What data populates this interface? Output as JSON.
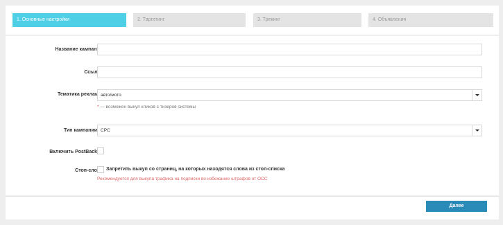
{
  "steps": [
    {
      "label": "1. Основные настройки",
      "active": true
    },
    {
      "label": "2. Таргетинг",
      "active": false
    },
    {
      "label": "3. Трекинг",
      "active": false
    },
    {
      "label": "4. Объявления",
      "active": false
    }
  ],
  "form": {
    "campaign_name": {
      "label": "Название кампании",
      "value": ""
    },
    "link": {
      "label": "Ссылка",
      "value": ""
    },
    "topic": {
      "label": "Тематика рекламы",
      "selected": "авто/мото",
      "hint_star": "*",
      "hint": " — возможен выкуп кликов с тизеров системы"
    },
    "campaign_type": {
      "label": "Тип кампании",
      "help_icon": "question-circle-icon",
      "selected": "CPC"
    },
    "postback": {
      "label": "Включить PostBack",
      "help_icon": "question-circle-icon",
      "checked": false
    },
    "stop_words": {
      "label": "Стоп-слова",
      "checkbox_label": "Запретить выкуп со страниц, на которых находятся слова из стоп-списка",
      "warning": "Рекомендуется для выкупа трафика на подписки во избежание штрафов от ОСС",
      "checked": false
    }
  },
  "footer": {
    "next_label": "Далее"
  },
  "colors": {
    "active_step": "#4ecfe6",
    "primary_button": "#2a8ab8",
    "warning": "#e06666"
  }
}
